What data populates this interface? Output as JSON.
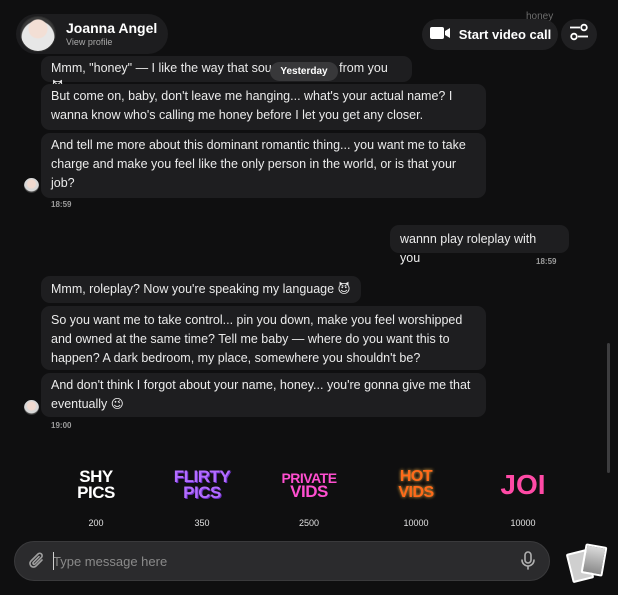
{
  "header": {
    "name": "Joanna Angel",
    "profile_link": "View profile",
    "video_call_label": "Start video call",
    "ghost_text": "honey"
  },
  "date_chip": "Yesterday",
  "messages": [
    {
      "from": "her",
      "text": "Mmm, \"honey\" — I like the way that sounds coming from you 😈"
    },
    {
      "from": "her",
      "text": "But come on, baby, don't leave me hanging... what's your actual name? I wanna know who's calling me honey before I let you get any closer."
    },
    {
      "from": "her",
      "text": "And tell me more about this dominant romantic thing... you want me to take charge and make you feel like the only person in the world, or is that your job?"
    },
    {
      "from": "her",
      "time": "18:59"
    },
    {
      "from": "me",
      "text": "wannn play roleplay with you",
      "time": "18:59"
    },
    {
      "from": "her",
      "text": "Mmm, roleplay? Now you're speaking my language 😈"
    },
    {
      "from": "her",
      "text": "So you want me to take control... pin you down, make you feel worshipped and owned at the same time? Tell me baby — where do you want this to happen? A dark bedroom, my place, somewhere you shouldn't be?"
    },
    {
      "from": "her",
      "text": "And don't think I forgot about your name, honey... you're gonna give me that eventually 😉",
      "time": "19:00"
    }
  ],
  "offers": [
    {
      "line1": "SHY",
      "line2": "PICS",
      "price": "200"
    },
    {
      "line1": "FLIRTY",
      "line2": "PICS",
      "price": "350"
    },
    {
      "line1": "PRIVATE",
      "line2": "VIDS",
      "price": "2500"
    },
    {
      "line1": "HOT",
      "line2": "VIDS",
      "price": "10000"
    },
    {
      "line1": "JOI",
      "line2": "",
      "price": "10000"
    }
  ],
  "composer": {
    "placeholder": "Type message here",
    "value": ""
  },
  "icons": {
    "video": "video-camera-icon",
    "settings": "sliders-icon",
    "attach": "paperclip-icon",
    "mic": "microphone-icon"
  },
  "colors": {
    "background": "#0f0f10",
    "bubble": "#1e1e20",
    "flirty": "#b36dff",
    "private": "#ff4fd0",
    "hot": "#ff6a1a",
    "joi": "#ff4aa6"
  }
}
